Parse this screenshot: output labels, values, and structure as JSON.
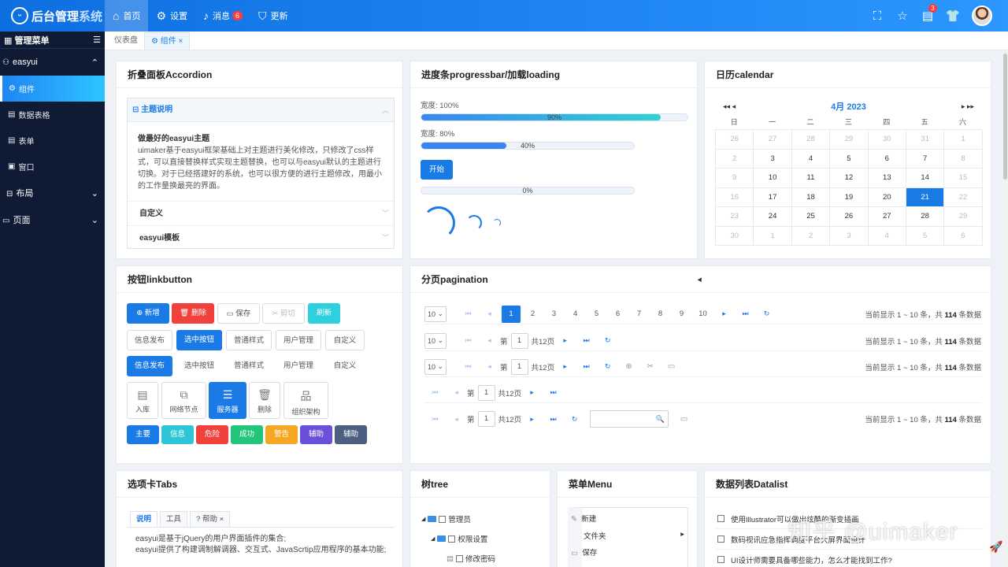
{
  "app": {
    "logo_icon": "smile-icon",
    "title_main": "后台管理",
    "title_sub": "系统"
  },
  "topnav": [
    {
      "label": "首页",
      "icon": "home-icon",
      "glyph": "⌂"
    },
    {
      "label": "设置",
      "icon": "gear-icon",
      "glyph": "⚙"
    },
    {
      "label": "消息",
      "icon": "bell-icon",
      "glyph": "🔔",
      "badge": "6"
    },
    {
      "label": "更新",
      "icon": "shield-icon",
      "glyph": "⛉"
    }
  ],
  "topright": {
    "note_badge": "3"
  },
  "sidebar": {
    "header": "管理菜单",
    "group": "easyui",
    "items": [
      {
        "label": "组件"
      },
      {
        "label": "数据表格"
      },
      {
        "label": "表单"
      },
      {
        "label": "窗口"
      },
      {
        "label": "布局"
      },
      {
        "label": "页面"
      }
    ]
  },
  "tabs": {
    "dashboard": "仪表盘",
    "components": "组件"
  },
  "accordion": {
    "title": "折叠面板Accordion",
    "header": "主题说明",
    "body_title": "做最好的easyui主题",
    "body_text": "uimaker基于easyui框架基础上对主题进行美化修改，只修改了css样式，可以直接替换样式实现主题替换，也可以与easyui默认的主题进行切换。对于已经搭建好的系统，也可以很方便的进行主题修改，用最小的工作量换最亮的界面。",
    "row2": "自定义",
    "row3": "easyui模板"
  },
  "progress": {
    "title": "进度条progressbar/加载loading",
    "label1": "宽度: 100%",
    "label2": "宽度: 80%",
    "bar1_value": 90,
    "bar1_text": "90%",
    "bar2_value": 40,
    "bar2_text": "40%",
    "bar3_value": 0,
    "bar3_text": "0%",
    "start": "开始"
  },
  "calendar": {
    "title": "日历calendar",
    "month": "4月 2023",
    "weekdays": [
      "日",
      "一",
      "二",
      "三",
      "四",
      "五",
      "六"
    ],
    "days": [
      {
        "d": "26",
        "o": true
      },
      {
        "d": "27",
        "o": true
      },
      {
        "d": "28",
        "o": true
      },
      {
        "d": "29",
        "o": true
      },
      {
        "d": "30",
        "o": true
      },
      {
        "d": "31",
        "o": true
      },
      {
        "d": "1",
        "o": true
      },
      {
        "d": "2",
        "o": true
      },
      {
        "d": "3"
      },
      {
        "d": "4"
      },
      {
        "d": "5"
      },
      {
        "d": "6"
      },
      {
        "d": "7"
      },
      {
        "d": "8",
        "o": true
      },
      {
        "d": "9",
        "o": true
      },
      {
        "d": "10"
      },
      {
        "d": "11"
      },
      {
        "d": "12"
      },
      {
        "d": "13"
      },
      {
        "d": "14"
      },
      {
        "d": "15",
        "o": true
      },
      {
        "d": "16",
        "o": true
      },
      {
        "d": "17"
      },
      {
        "d": "18"
      },
      {
        "d": "19"
      },
      {
        "d": "20"
      },
      {
        "d": "21",
        "sel": true
      },
      {
        "d": "22",
        "o": true
      },
      {
        "d": "23",
        "o": true
      },
      {
        "d": "24"
      },
      {
        "d": "25"
      },
      {
        "d": "26"
      },
      {
        "d": "27"
      },
      {
        "d": "28"
      },
      {
        "d": "29",
        "o": true
      },
      {
        "d": "30",
        "o": true
      },
      {
        "d": "1",
        "o": true
      },
      {
        "d": "2",
        "o": true
      },
      {
        "d": "3",
        "o": true
      },
      {
        "d": "4",
        "o": true
      },
      {
        "d": "5",
        "o": true
      },
      {
        "d": "6",
        "o": true
      }
    ]
  },
  "buttons": {
    "title": "按钮linkbutton",
    "row1": [
      {
        "label": "新增",
        "icon": "plus-circle-icon",
        "glyph": "⊕ "
      },
      {
        "label": "删除",
        "icon": "trash-icon",
        "glyph": "🗑 "
      },
      {
        "label": "保存",
        "icon": "save-icon",
        "glyph": "▭ "
      },
      {
        "label": "剪切",
        "icon": "scissors-icon",
        "glyph": "✂ "
      },
      {
        "label": "刷新",
        "icon": "",
        "glyph": ""
      }
    ],
    "row2": [
      "信息发布",
      "选中按钮",
      "普通样式",
      "用户管理",
      "自定义"
    ],
    "row3": [
      "信息发布",
      "选中按钮",
      "普通样式",
      "用户管理",
      "自定义"
    ],
    "tiles": [
      {
        "label": "入库",
        "icon": "inbox-icon",
        "glyph": "▤"
      },
      {
        "label": "网络节点",
        "icon": "network-icon",
        "glyph": "⧉"
      },
      {
        "label": "服务器",
        "icon": "server-icon",
        "glyph": "☰"
      },
      {
        "label": "删除",
        "icon": "trash-icon",
        "glyph": "🗑"
      },
      {
        "label": "组织架构",
        "icon": "org-chart-icon",
        "glyph": "品"
      }
    ],
    "colors": [
      {
        "label": "主要",
        "color": "#1a7be6"
      },
      {
        "label": "信息",
        "color": "#2ec6d6"
      },
      {
        "label": "危险",
        "color": "#f0413b"
      },
      {
        "label": "成功",
        "color": "#22c57a"
      },
      {
        "label": "警告",
        "color": "#f5a623"
      },
      {
        "label": "辅助",
        "color": "#6a4fd9"
      },
      {
        "label": "辅助",
        "color": "#4d5f80"
      }
    ]
  },
  "pagination": {
    "title": "分页pagination",
    "page_size": "10",
    "pages": [
      "1",
      "2",
      "3",
      "4",
      "5",
      "6",
      "7",
      "8",
      "9",
      "10"
    ],
    "prefix": "第",
    "page": "1",
    "total_pages": "共12页",
    "info_prefix": "当前显示 1 ~ 10 条，共",
    "info_total": "114",
    "info_suffix": "条数据"
  },
  "tabsPanel": {
    "title": "选项卡Tabs",
    "tab1": "说明",
    "tab2": "工具",
    "tab3": "帮助",
    "line1": "easyui是基于jQuery的用户界面插件的集合;",
    "line2": "easyui提供了构建调制解调器、交互式、JavaScrtip应用程序的基本功能;"
  },
  "tree": {
    "title": "树tree",
    "n1": "管理员",
    "n2": "权限设置",
    "n3": "修改密码"
  },
  "menu": {
    "title": "菜单Menu",
    "i1": "新建",
    "i2": "文件夹",
    "i3": "保存"
  },
  "datalist": {
    "title": "数据列表Datalist",
    "items": [
      "使用Illustrator可以做出炫酷的渐变插画",
      "数码视讯应急指挥调度平台大屏界面设计",
      "UI设计师需要具备哪些能力，怎么才能找到工作?"
    ]
  },
  "watermark": "知乎 @uimaker"
}
